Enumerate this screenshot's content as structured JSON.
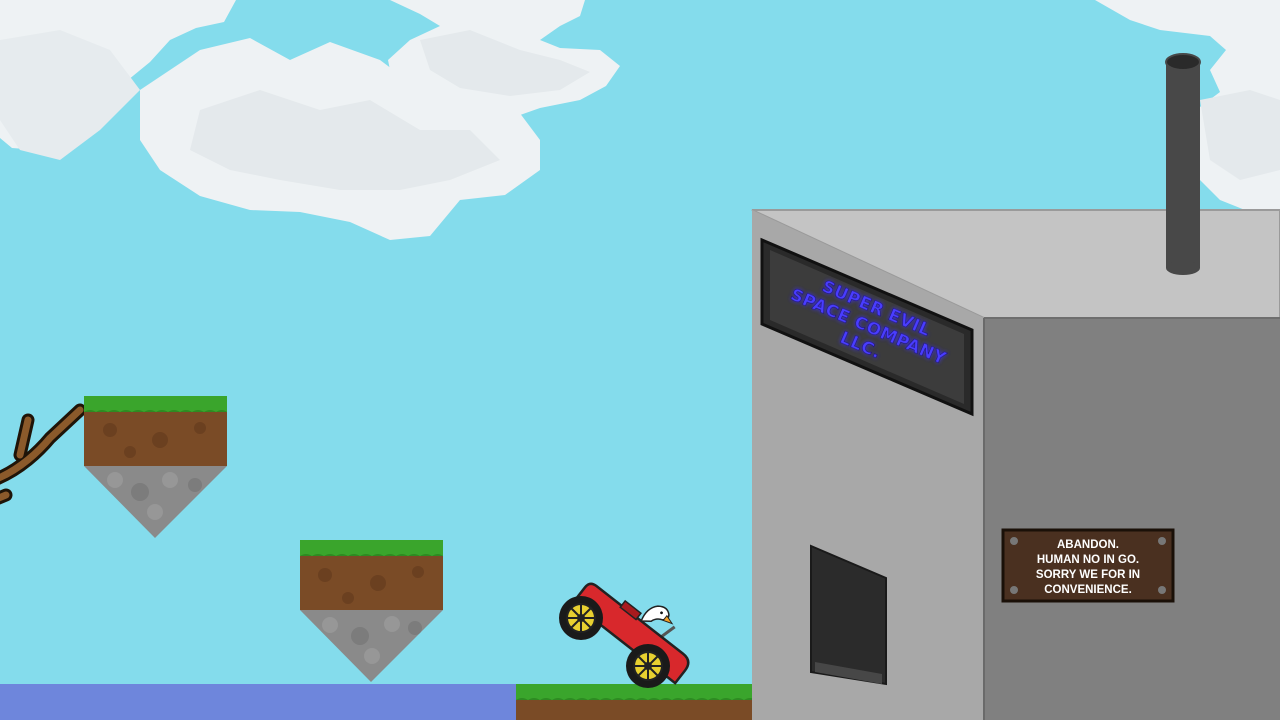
{
  "colors": {
    "sky": "#84dcec",
    "water": "#6e86dc",
    "grass": "#3aa52c",
    "dirt": "#7a4b26",
    "stone": "#8c8c8c",
    "building_front": "#808080",
    "building_side": "#a8a8a8",
    "building_roof": "#c4c4c4",
    "chimney": "#484848",
    "car_body": "#d8282c",
    "wheel_rim": "#e8d030",
    "sign_board": "#4a3020"
  },
  "company_sign": {
    "line1": "SUPER EVIL",
    "line2": "SPACE COMPANY",
    "line3": "LLC."
  },
  "notice_sign": {
    "line1": "ABANDON.",
    "line2": "HUMAN NO IN GO.",
    "line3": "SORRY WE FOR IN",
    "line4": "CONVENIENCE."
  },
  "icons": {
    "car": "red-buggy-icon",
    "driver": "goose-icon",
    "branch": "tree-branch-icon"
  }
}
